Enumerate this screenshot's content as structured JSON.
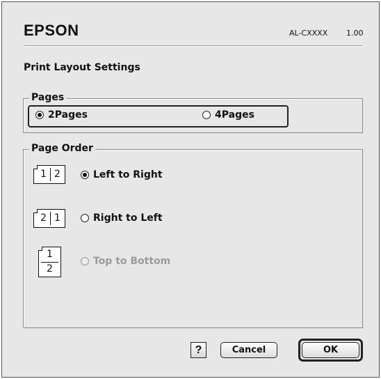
{
  "header": {
    "brand": "EPSON",
    "model": "AL-CXXXX",
    "version": "1.00"
  },
  "dialog": {
    "title": "Print Layout Settings"
  },
  "pages": {
    "label": "Pages",
    "options": [
      {
        "label": "2Pages",
        "selected": true
      },
      {
        "label": "4Pages",
        "selected": false
      }
    ]
  },
  "page_order": {
    "label": "Page Order",
    "options": [
      {
        "label": "Left to Right",
        "selected": true,
        "enabled": true,
        "icon": "order-left-to-right-icon",
        "icon_cells": [
          "1",
          "2"
        ]
      },
      {
        "label": "Right to Left",
        "selected": false,
        "enabled": true,
        "icon": "order-right-to-left-icon",
        "icon_cells": [
          "2",
          "1"
        ]
      },
      {
        "label": "Top to Bottom",
        "selected": false,
        "enabled": false,
        "icon": "order-top-to-bottom-icon",
        "icon_cells": [
          "1",
          "2"
        ]
      }
    ]
  },
  "buttons": {
    "help": "?",
    "cancel": "Cancel",
    "ok": "OK"
  }
}
